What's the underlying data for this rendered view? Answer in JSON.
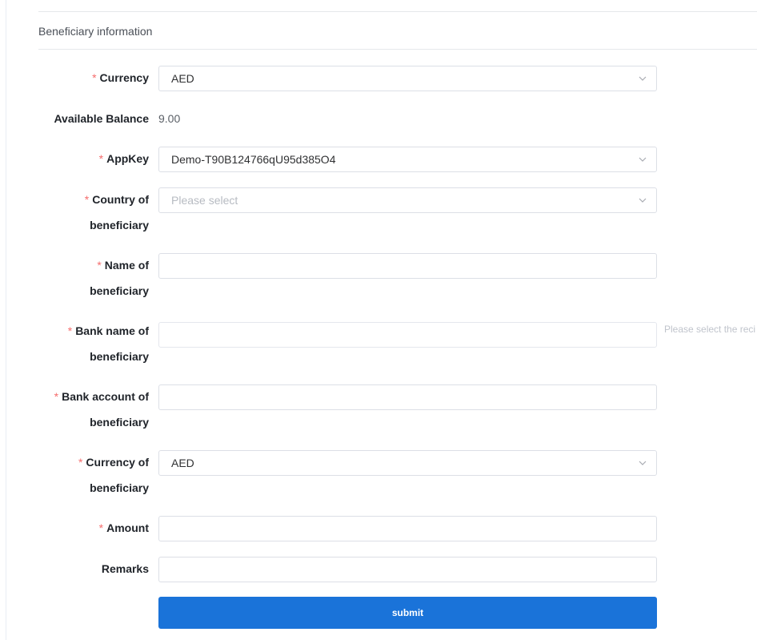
{
  "section": {
    "title": "Beneficiary information"
  },
  "form": {
    "currency": {
      "label": "Currency",
      "value": "AED"
    },
    "available_balance": {
      "label": "Available Balance",
      "value": "9.00"
    },
    "appkey": {
      "label": "AppKey",
      "value": "Demo-T90B124766qU95d385O4"
    },
    "country": {
      "label_line1": "Country of",
      "label_line2": "beneficiary",
      "placeholder": "Please select"
    },
    "name": {
      "label_line1": "Name of",
      "label_line2": "beneficiary",
      "value": ""
    },
    "bank_name": {
      "label_line1": "Bank name of",
      "label_line2": "beneficiary",
      "value": "",
      "hint": "Please select the reci"
    },
    "bank_account": {
      "label_line1": "Bank account of",
      "label_line2": "beneficiary",
      "value": ""
    },
    "currency_of_beneficiary": {
      "label_line1": "Currency of",
      "label_line2": "beneficiary",
      "value": "AED"
    },
    "amount": {
      "label": "Amount",
      "value": ""
    },
    "remarks": {
      "label": "Remarks",
      "value": ""
    },
    "submit_label": "submit"
  },
  "icons": {
    "select_arrow": "chevron-down-icon"
  },
  "colors": {
    "primary": "#1a73d9",
    "required": "#f56c6c",
    "border": "#dcdfe6"
  }
}
